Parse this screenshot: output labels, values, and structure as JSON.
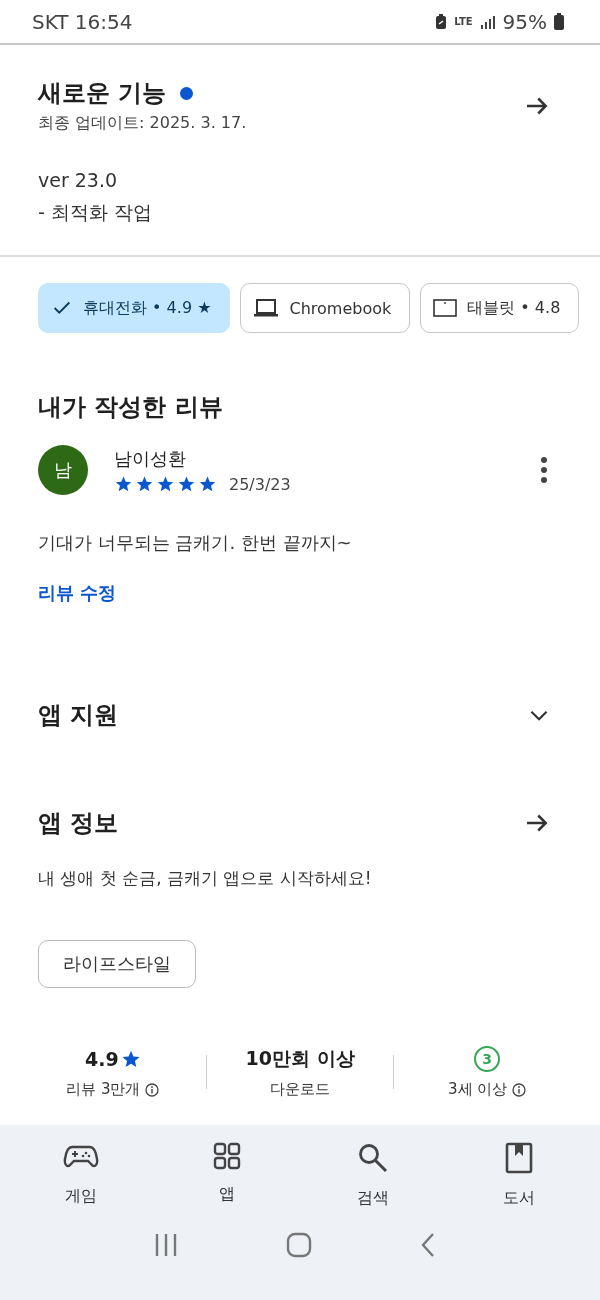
{
  "status_bar": {
    "carrier_time": "SKT 16:54",
    "network": "LTE",
    "battery": "95%"
  },
  "whats_new": {
    "title": "새로운 기능",
    "new": true,
    "updated": "최종 업데이트: 2025. 3. 17.",
    "lines": [
      "ver 23.0",
      "- 최적화 작업"
    ]
  },
  "device_chips": [
    {
      "label": "휴대전화 • 4.9 ★",
      "selected": true
    },
    {
      "kind": "laptop",
      "label": "Chromebook",
      "selected": false
    },
    {
      "kind": "tablet",
      "label": "태블릿 • 4.8",
      "selected": false
    }
  ],
  "my_review": {
    "heading": "내가 작성한 리뷰",
    "avatar": "남",
    "author": "남이성환",
    "stars": 5,
    "date": "25/3/23",
    "text": "기대가 너무되는 금캐기. 한번 끝까지~",
    "edit_link": "리뷰 수정"
  },
  "app_support": {
    "title": "앱 지원",
    "expanded": false
  },
  "app_info": {
    "title": "앱 정보",
    "description": "내 생애 첫 순금, 금캐기 앱으로 시작하세요!",
    "category": "라이프스타일"
  },
  "stats": [
    {
      "kind": "rating",
      "value": "4.9",
      "label": "리뷰 3만개"
    },
    {
      "kind": "downloads",
      "value": "10만회 이상",
      "label": "다운로드"
    },
    {
      "kind": "age",
      "value": "3",
      "label": "3세 이상"
    }
  ],
  "bottom_nav": [
    {
      "kind": "games",
      "label": "게임"
    },
    {
      "kind": "apps",
      "label": "앱"
    },
    {
      "kind": "search",
      "label": "검색"
    },
    {
      "kind": "books",
      "label": "도서"
    }
  ]
}
